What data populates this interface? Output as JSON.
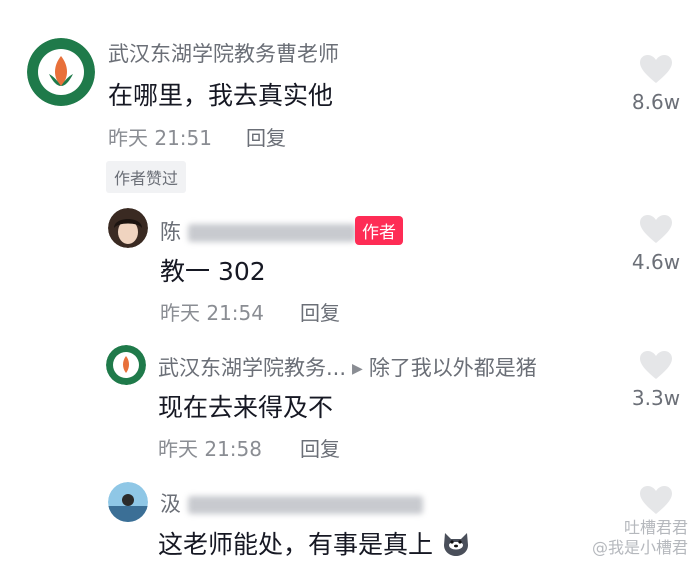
{
  "comments": [
    {
      "author": "武汉东湖学院教务曹老师",
      "text": "在哪里，我去真实他",
      "time": "昨天 21:51",
      "reply_label": "回复",
      "badge": "作者赞过",
      "likes": "8.6w"
    },
    {
      "author_visible": "陈",
      "author_blur_hint": "我觉 都是猪",
      "author_badge": "作者",
      "text": "教一 302",
      "time": "昨天 21:54",
      "reply_label": "回复",
      "likes": "4.6w"
    },
    {
      "author": "武汉东湖学院教务...",
      "reply_to": "除了我以外都是猪",
      "text": "现在去来得及不",
      "time": "昨天 21:58",
      "reply_label": "回复",
      "likes": "3.3w"
    },
    {
      "author_visible": "汲",
      "author_blur_hint": "都是猪",
      "text": "这老师能处，有事是真上",
      "emoji": "dog-emoji"
    }
  ],
  "watermark": {
    "line1": "吐槽君君",
    "line2": "@我是小槽君"
  },
  "colors": {
    "accent": "#fe2c55",
    "secondary_text": "#6b6f77",
    "heart": "#e5e6e8"
  }
}
